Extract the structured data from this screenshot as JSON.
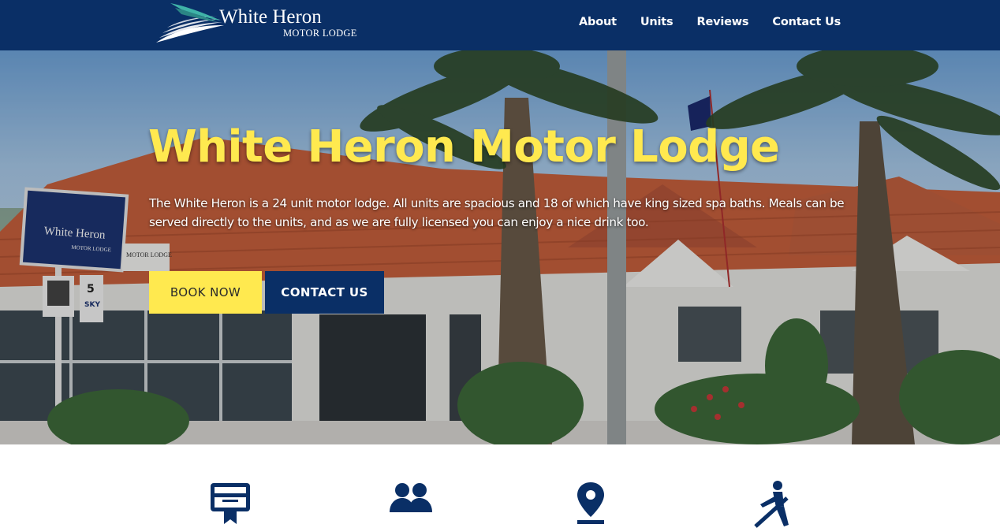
{
  "brand": {
    "name": "White Heron",
    "tagline": "MOTOR LODGE",
    "primary_color": "#0a2f66",
    "accent_color": "#ffe94f"
  },
  "nav": {
    "items": [
      {
        "label": "About"
      },
      {
        "label": "Units"
      },
      {
        "label": "Reviews"
      },
      {
        "label": "Contact Us"
      }
    ]
  },
  "hero": {
    "title": "White Heron Motor Lodge",
    "description": "The White Heron is a 24 unit motor lodge. All units are spacious and 18 of which have king sized spa baths. Meals can be served directly to the units, and as we are fully licensed you can enjoy a nice drink too.",
    "book_label": "BOOK NOW",
    "contact_label": "CONTACT US",
    "sign": {
      "name": "White Heron",
      "sub": "MOTOR LODGE",
      "unit_number": "5",
      "sky": "SKY"
    }
  },
  "features": [
    {
      "icon": "card-icon"
    },
    {
      "icon": "group-icon"
    },
    {
      "icon": "map-pin-icon"
    },
    {
      "icon": "golf-cart-icon"
    }
  ]
}
